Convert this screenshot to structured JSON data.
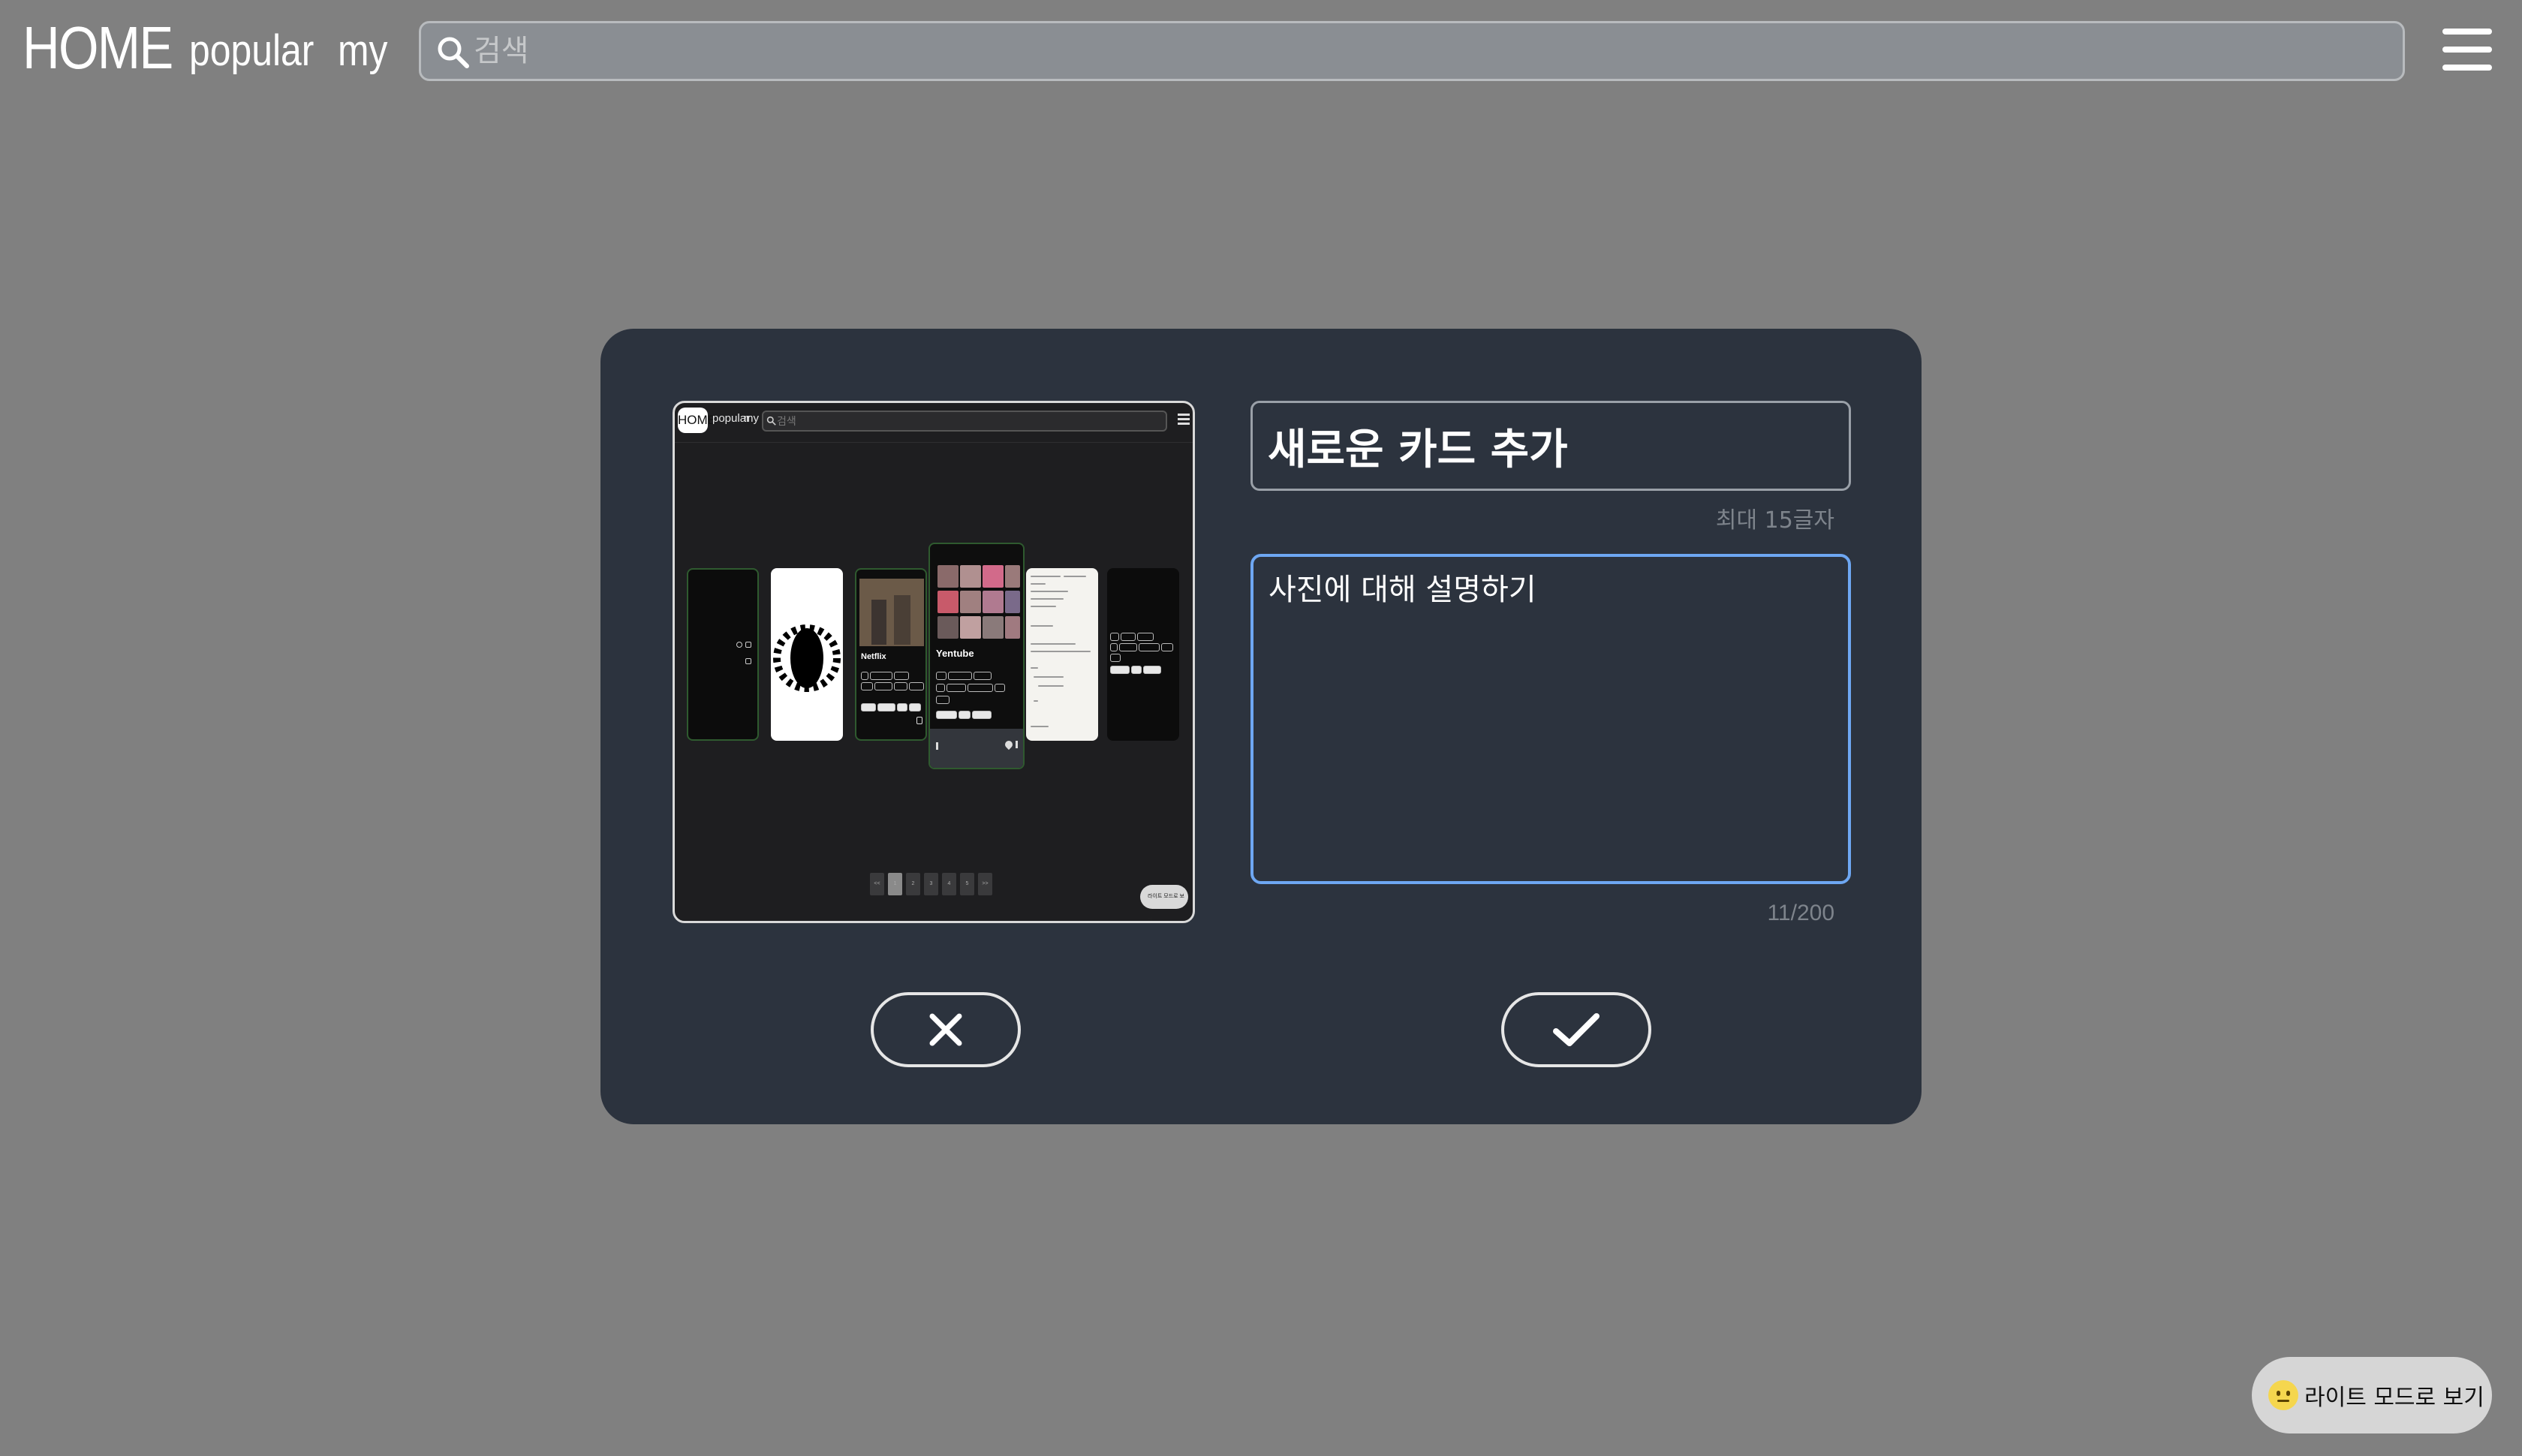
{
  "nav": {
    "home": "HOME",
    "popular": "popular",
    "my": "my",
    "search_placeholder": "검색",
    "search_icon": "search-icon",
    "menu_icon": "hamburger-menu-icon"
  },
  "modal": {
    "title_value": "새로운 카드 추가",
    "title_hint": "최대 15글자",
    "description_value": "사진에 대해 설명하기",
    "description_count": "11/200",
    "cancel_icon": "close-icon",
    "confirm_icon": "check-icon",
    "accent_color": "#6ea7f2"
  },
  "preview": {
    "nav_home": "HOME",
    "nav_popular": "popular",
    "nav_my": "my",
    "search_placeholder": "검색",
    "card_netflix_title": "Netflix",
    "card_yentube_title": "Yentube",
    "pagination": [
      "<<",
      "1",
      "2",
      "3",
      "4",
      "5",
      ">>"
    ],
    "theme_label": "라이트 모드로 보기"
  },
  "theme_toggle": {
    "label": "라이트 모드로 보기",
    "icon": "smiley-emoji-icon"
  }
}
